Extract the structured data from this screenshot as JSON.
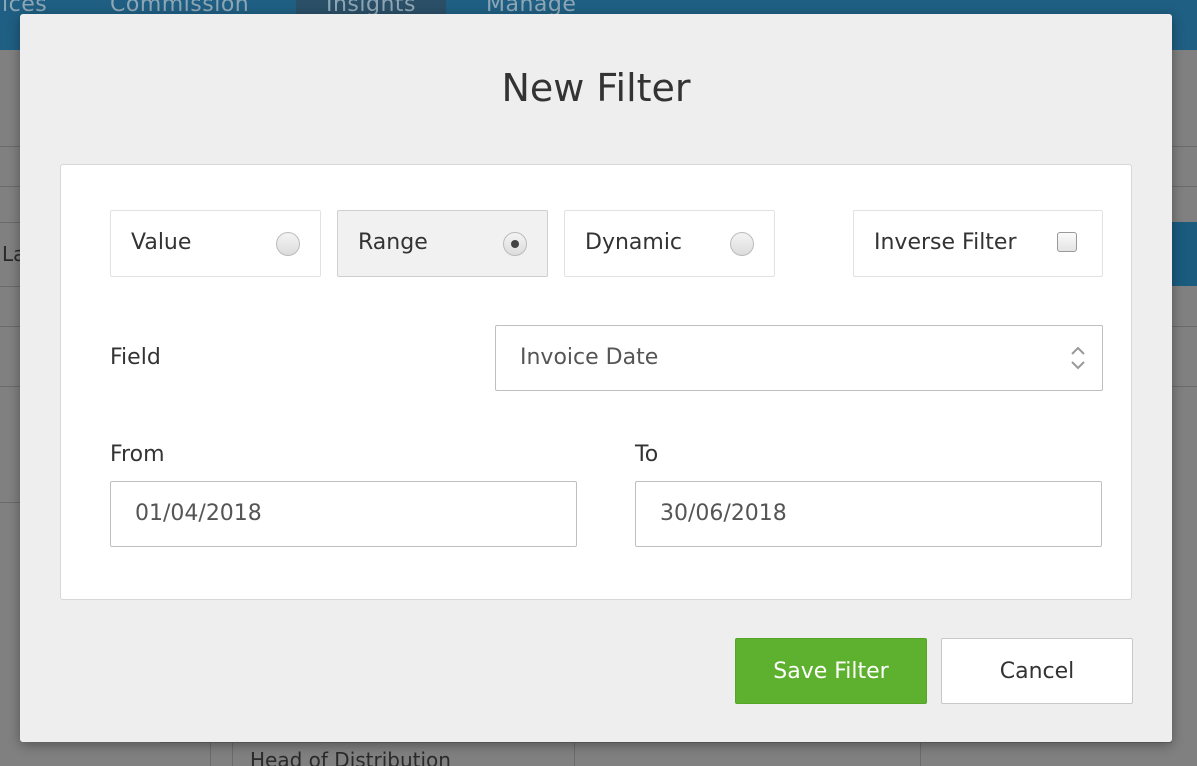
{
  "background": {
    "nav_items": [
      "ices",
      "Commission",
      "Insights",
      "Manage"
    ],
    "left_text": "La",
    "bottom_text": "Head of Distribution"
  },
  "modal": {
    "title": "New Filter",
    "filter_types": [
      {
        "label": "Value",
        "selected": false
      },
      {
        "label": "Range",
        "selected": true
      },
      {
        "label": "Dynamic",
        "selected": false
      }
    ],
    "inverse_filter": {
      "label": "Inverse Filter",
      "checked": false
    },
    "field": {
      "label": "Field",
      "value": "Invoice Date"
    },
    "from": {
      "label": "From",
      "value": "01/04/2018"
    },
    "to": {
      "label": "To",
      "value": "30/06/2018"
    },
    "buttons": {
      "save": "Save Filter",
      "cancel": "Cancel"
    }
  },
  "colors": {
    "save_button": "#5eb12e",
    "topbar": "#1f5f83"
  }
}
